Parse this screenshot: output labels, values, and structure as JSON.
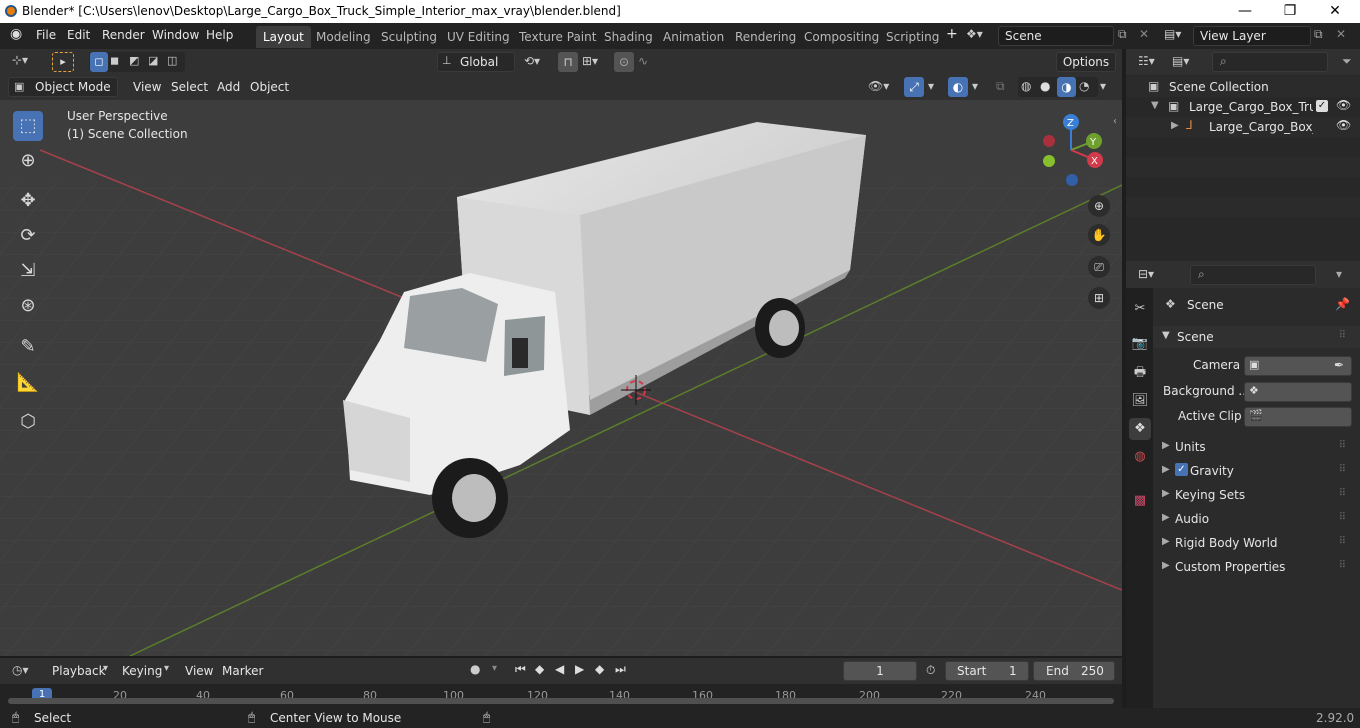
{
  "titlebar": {
    "title": "Blender* [C:\\Users\\lenov\\Desktop\\Large_Cargo_Box_Truck_Simple_Interior_max_vray\\blender.blend]",
    "minimize": "—",
    "maximize": "❐",
    "close": "✕"
  },
  "menus": [
    "File",
    "Edit",
    "Render",
    "Window",
    "Help"
  ],
  "workspaces": [
    "Layout",
    "Modeling",
    "Sculpting",
    "UV Editing",
    "Texture Paint",
    "Shading",
    "Animation",
    "Rendering",
    "Compositing",
    "Scripting"
  ],
  "add_tab": "+",
  "scene_field": "Scene",
  "view_layer_field": "View Layer",
  "viewport": {
    "transform_orientation": "Global",
    "options": "Options",
    "mode": "Object Mode",
    "header_menus": [
      "View",
      "Select",
      "Add",
      "Object"
    ],
    "overlay_line1": "User Perspective",
    "overlay_line2": "(1) Scene Collection",
    "gizmo": {
      "x": "X",
      "y": "Y",
      "z": "Z"
    }
  },
  "outliner": {
    "root": "Scene Collection",
    "items": [
      {
        "label": "Large_Cargo_Box_Truck_"
      },
      {
        "label": "Large_Cargo_Box_Tr"
      }
    ]
  },
  "properties": {
    "context": "Scene",
    "panel": "Scene",
    "rows": [
      {
        "label": "Camera"
      },
      {
        "label": "Background ..."
      },
      {
        "label": "Active Clip"
      }
    ],
    "subpanels": [
      "Units",
      "Gravity",
      "Keying Sets",
      "Audio",
      "Rigid Body World",
      "Custom Properties"
    ]
  },
  "timeline": {
    "menus": [
      "Playback",
      "Keying",
      "View",
      "Marker"
    ],
    "current_frame": "1",
    "start_label": "Start",
    "start": "1",
    "end_label": "End",
    "end": "250",
    "ticks": [
      "1",
      "20",
      "40",
      "60",
      "80",
      "100",
      "120",
      "140",
      "160",
      "180",
      "200",
      "220",
      "240"
    ]
  },
  "statusbar": {
    "select": "Select",
    "center": "Center View to Mouse",
    "version": "2.92.0"
  },
  "colors": {
    "accent": "#4772b3",
    "x_axis": "#d23b4b",
    "y_axis": "#6ea02d",
    "z_axis": "#3a7fd6"
  }
}
